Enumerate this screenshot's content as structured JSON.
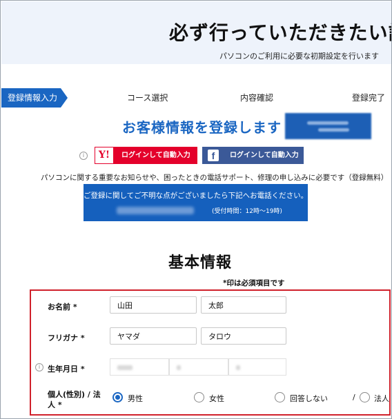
{
  "header": {
    "title": "必ず行っていただきたい設",
    "subtitle": "パソコンのご利用に必要な初期設定を行います"
  },
  "steps": {
    "items": [
      "登録情報入力",
      "コース選択",
      "内容確認",
      "登録完了"
    ],
    "active_index": 0
  },
  "registration": {
    "title": "お客様情報を登録します",
    "yahoo_logo": "Y!",
    "yahoo_label": "ログインして自動入力",
    "facebook_logo": "f",
    "facebook_label": "ログインして自動入力",
    "notice": "パソコンに関する重要なお知らせや、困ったときの電話サポート、修理の申し込みに必要です（登録無料）",
    "contact_message": "ご登録に関してご不明な点がございましたら下記へお電話ください。",
    "contact_hours": "(受付時間：12時〜19時)"
  },
  "basic_info": {
    "title": "基本情報",
    "required_note": "*印は必須項目です",
    "name_label": "お名前 *",
    "last_name": "山田",
    "first_name": "太郎",
    "furigana_label": "フリガナ *",
    "last_kana": "ヤマダ",
    "first_kana": "タロウ",
    "dob_label": "生年月日 *",
    "gender_label_line1": "個人(性別) / 法",
    "gender_label_line2": "人 *",
    "gender_options": [
      "男性",
      "女性",
      "回答しない",
      "法人"
    ],
    "separator": "/",
    "selected_gender": "男性"
  },
  "colors": {
    "accent": "#1a66c2",
    "yahoo": "#e4002b",
    "facebook": "#3b5998",
    "highlight_border": "#d0202a"
  }
}
